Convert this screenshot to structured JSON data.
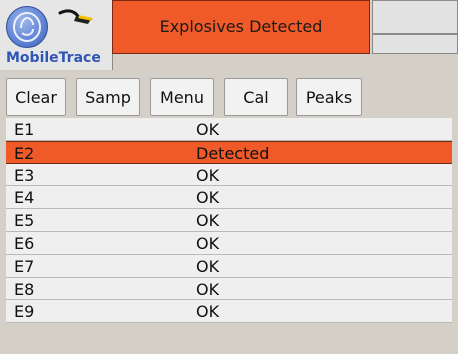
{
  "brand": {
    "name": "MobileTrace"
  },
  "alert": {
    "text": "Explosives Detected"
  },
  "toolbar": {
    "buttons": [
      {
        "label": "Clear"
      },
      {
        "label": "Samp"
      },
      {
        "label": "Menu"
      },
      {
        "label": "Cal"
      },
      {
        "label": "Peaks"
      }
    ]
  },
  "results": [
    {
      "id": "E1",
      "status": "OK"
    },
    {
      "id": "E2",
      "status": "Detected"
    },
    {
      "id": "E3",
      "status": "OK"
    },
    {
      "id": "E4",
      "status": "OK"
    },
    {
      "id": "E5",
      "status": "OK"
    },
    {
      "id": "E6",
      "status": "OK"
    },
    {
      "id": "E7",
      "status": "OK"
    },
    {
      "id": "E8",
      "status": "OK"
    },
    {
      "id": "E9",
      "status": "OK"
    }
  ],
  "colors": {
    "alert": "#f05a28",
    "background": "#d4d0c8",
    "brand_blue": "#2d56b5"
  },
  "icons": {
    "logo": "ge-logo",
    "plug": "plug-icon"
  }
}
